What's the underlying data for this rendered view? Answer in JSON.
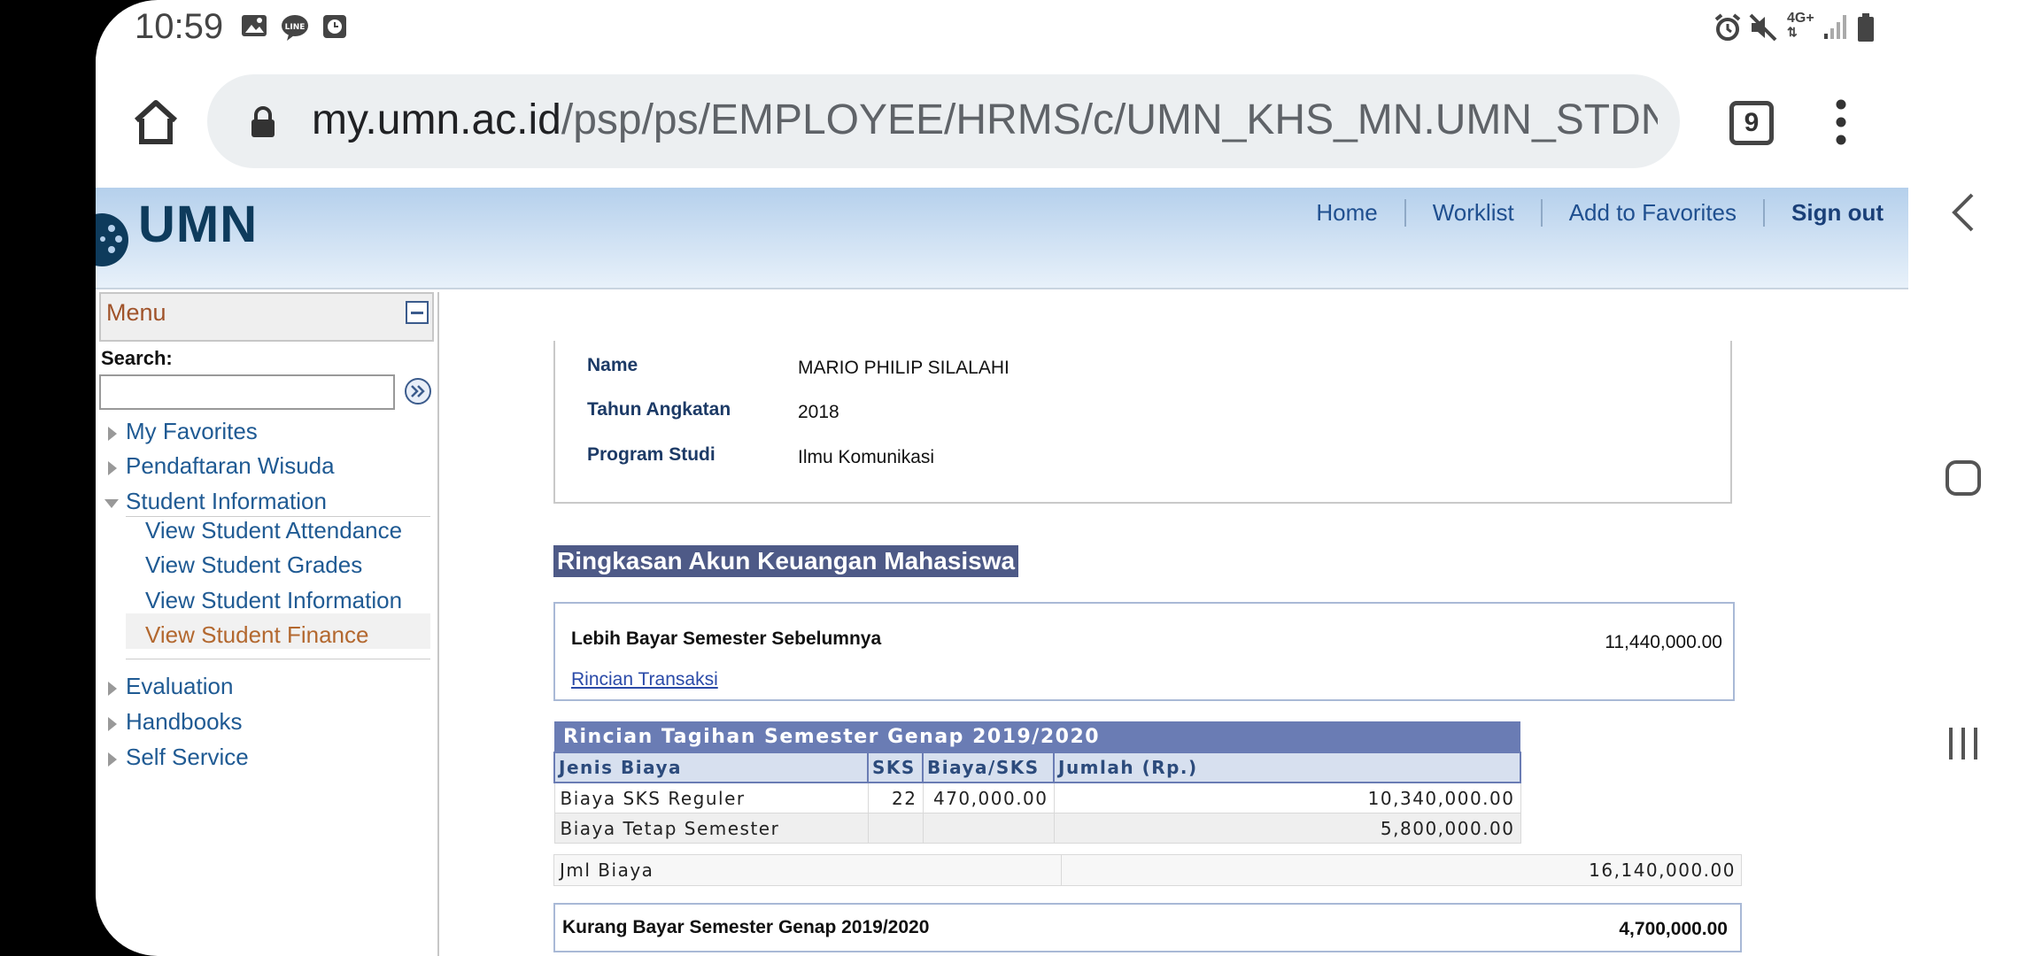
{
  "status_bar": {
    "time": "10:59",
    "left_icons": [
      "gallery-icon",
      "line-app-icon",
      "clock-app-icon"
    ],
    "right_icons": [
      "alarm-icon",
      "mute-icon",
      "network-4g-icon",
      "signal-icon",
      "battery-icon"
    ],
    "network_label": "4G+"
  },
  "browser": {
    "url_host": "my.umn.ac.id",
    "url_path": "/psp/ps/EMPLOYEE/HRMS/c/UMN_KHS_MN.UMN_STDNT_A",
    "tab_count": "9"
  },
  "header": {
    "logo_text": "UMN",
    "links": [
      "Home",
      "Worklist",
      "Add to Favorites",
      "Sign out"
    ]
  },
  "menu": {
    "title": "Menu",
    "search_label": "Search:",
    "search_value": "",
    "items": [
      "My Favorites",
      "Pendaftaran Wisuda",
      "Student Information"
    ],
    "sub_items": [
      "View Student Attendance",
      "View Student Grades",
      "View Student Information",
      "View Student Finance"
    ],
    "bottom_items": [
      "Evaluation",
      "Handbooks",
      "Self Service"
    ]
  },
  "student": {
    "name_label": "Name",
    "name_value": "MARIO PHILIP SILALAHI",
    "year_label": "Tahun Angkatan",
    "year_value": "2018",
    "program_label": "Program Studi",
    "program_value": "Ilmu Komunikasi"
  },
  "summary": {
    "title": "Ringkasan Akun Keuangan Mahasiswa",
    "overpay_label": "Lebih Bayar Semester Sebelumnya",
    "overpay_amount": "11,440,000.00",
    "detail_link": "Rincian Transaksi"
  },
  "bill": {
    "caption": "Rincian Tagihan Semester Genap 2019/2020",
    "headers": [
      "Jenis Biaya",
      "SKS",
      "Biaya/SKS",
      "Jumlah (Rp.)"
    ],
    "rows": [
      {
        "jenis": "Biaya SKS Reguler",
        "sks": "22",
        "biaya": "470,000.00",
        "jumlah": "10,340,000.00"
      },
      {
        "jenis": "Biaya Tetap Semester",
        "sks": "",
        "biaya": "",
        "jumlah": "5,800,000.00"
      }
    ],
    "total_label": "Jml Biaya",
    "total_amount": "16,140,000.00",
    "underpay_label": "Kurang Bayar Semester Genap 2019/2020",
    "underpay_amount": "4,700,000.00"
  },
  "colors": {
    "header_gradient_top": "#b5d0ec",
    "menu_title": "#a0532a",
    "link": "#1f5a93",
    "section_title_bg": "#4e5a87",
    "table_caption_bg": "#6a7cb4"
  }
}
